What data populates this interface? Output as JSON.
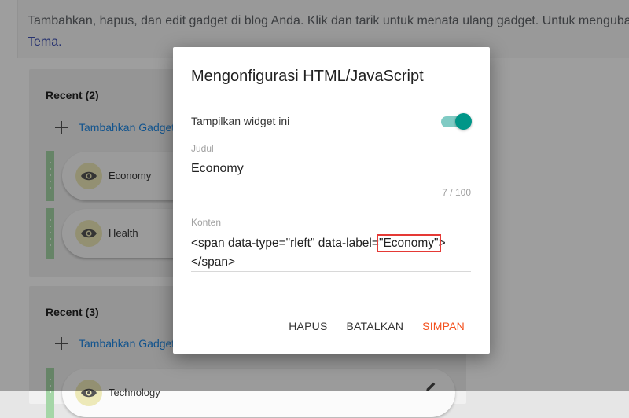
{
  "background": {
    "intro_text": "Tambahkan, hapus, dan edit gadget di blog Anda. Klik dan tarik untuk menata ulang gadget. Untuk mengubah",
    "intro_link": "Tema.",
    "sections": [
      {
        "title": "Recent (2)",
        "add_label": "Tambahkan Gadget",
        "gadgets": [
          {
            "name": "Economy"
          },
          {
            "name": "Health"
          }
        ]
      },
      {
        "title": "Recent (3)",
        "add_label": "Tambahkan Gadget",
        "gadgets": [
          {
            "name": "Technology"
          }
        ]
      }
    ]
  },
  "dialog": {
    "title": "Mengonfigurasi HTML/JavaScript",
    "toggle_label": "Tampilkan widget ini",
    "toggle_on": true,
    "judul_label": "Judul",
    "judul_value": "Economy",
    "counter": "7 / 100",
    "konten_label": "Konten",
    "konten_before": "<span data-type=\"rleft\" data-label=",
    "konten_highlight": "\"Economy\"",
    "konten_after": ">",
    "konten_line2": "</span>",
    "buttons": {
      "delete": "HAPUS",
      "cancel": "BATALKAN",
      "save": "SIMPAN"
    }
  },
  "colors": {
    "accent": "#f4511e",
    "toggle": "#009688",
    "link": "#3f51b5",
    "add_link": "#1e88e5",
    "grip": "#a5d6a7",
    "highlight_box": "#e53935"
  }
}
